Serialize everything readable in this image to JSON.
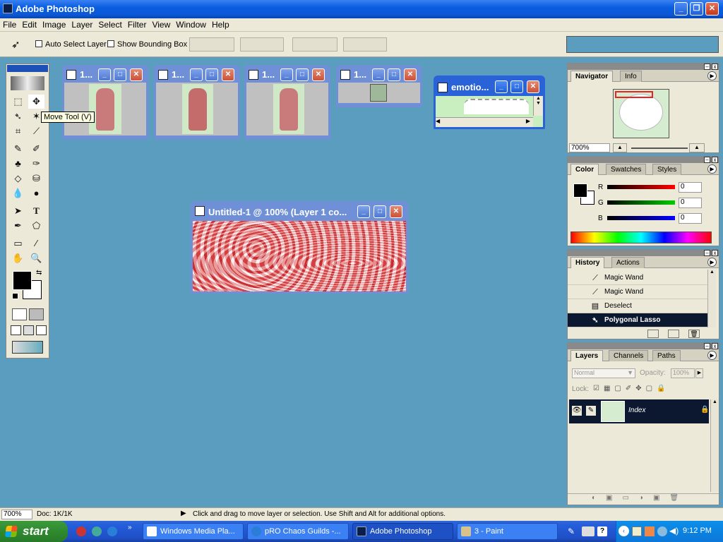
{
  "app": {
    "title": "Adobe Photoshop"
  },
  "menu": [
    "File",
    "Edit",
    "Image",
    "Layer",
    "Select",
    "Filter",
    "View",
    "Window",
    "Help"
  ],
  "options": {
    "auto_select": "Auto Select Layer",
    "show_bounding": "Show Bounding Box"
  },
  "tooltip": "Move Tool (V)",
  "docs": {
    "d1": "1...",
    "d2": "1...",
    "d3": "1...",
    "d4": "1...",
    "emotion": "emotio...",
    "untitled": "Untitled-1 @ 100% (Layer 1 co..."
  },
  "navigator": {
    "tabs": [
      "Navigator",
      "Info"
    ],
    "zoom": "700%"
  },
  "color": {
    "tabs": [
      "Color",
      "Swatches",
      "Styles"
    ],
    "channels": [
      {
        "label": "R",
        "value": "0"
      },
      {
        "label": "G",
        "value": "0"
      },
      {
        "label": "B",
        "value": "0"
      }
    ]
  },
  "history": {
    "tabs": [
      "History",
      "Actions"
    ],
    "items": [
      "Magic Wand",
      "Magic Wand",
      "Deselect",
      "Polygonal Lasso"
    ]
  },
  "layers": {
    "tabs": [
      "Layers",
      "Channels",
      "Paths"
    ],
    "blend_mode": "Normal",
    "opacity_label": "Opacity:",
    "opacity": "100%",
    "lock_label": "Lock:",
    "layer_name": "Index"
  },
  "status": {
    "zoom": "700%",
    "doc": "Doc: 1K/1K",
    "hint": "Click and drag to move layer or selection.  Use Shift and Alt for additional options."
  },
  "taskbar": {
    "start": "start",
    "tasks": [
      "Windows Media Pla...",
      "pRO Chaos Guilds -...",
      "Adobe Photoshop",
      "3 - Paint"
    ],
    "clock": "9:12 PM"
  },
  "colors": {
    "xp_blue": "#0a5ee0",
    "desktop": "#5b9dbf",
    "chrome": "#ece9d8"
  }
}
